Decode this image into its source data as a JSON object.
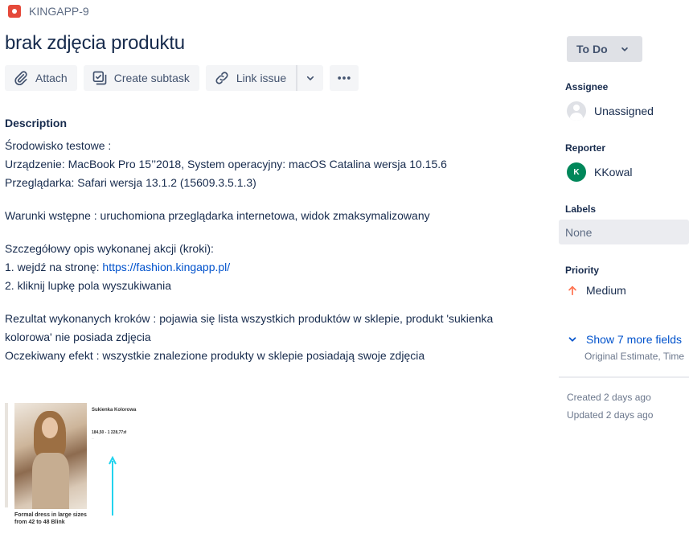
{
  "issue": {
    "key": "KINGAPP-9",
    "type_icon": "bug-icon",
    "title": "brak zdjęcia produktu"
  },
  "toolbar": {
    "attach_label": "Attach",
    "create_subtask_label": "Create subtask",
    "link_issue_label": "Link issue",
    "more_icon": "ellipsis-icon"
  },
  "description": {
    "heading": "Description",
    "env_heading": "Środowisko testowe :",
    "device": "Urządzenie: MacBook Pro 15’’2018, System operacyjny: macOS Catalina wersja 10.15.6",
    "browser": "Przeglądarka: Safari wersja 13.1.2 (15609.3.5.1.3)",
    "preconditions": "Warunki wstępne : uruchomiona przeglądarka internetowa, widok zmaksymalizowany",
    "steps_heading": "Szczegółowy opis wykonanej akcji (kroki):",
    "step1_prefix": "1. wejdź na stronę: ",
    "step1_link": "https://fashion.kingapp.pl/",
    "step2": "2. kliknij lupkę pola wyszukiwania",
    "result": "Rezultat wykonanych kroków : pojawia się lista wszystkich produktów w sklepie, produkt 'sukienka kolorowa' nie posiada zdjęcia",
    "expected": "Oczekiwany efekt : wszystkie znalezione produkty w sklepie posiadają swoje zdjęcia"
  },
  "attachment": {
    "product_name": "Sukienka Kolorowa",
    "price": "184,50 - 1 228,77zł",
    "price_sub": "...",
    "caption": "Formal dress in large sizes from 42 to 48 Blink"
  },
  "sidebar": {
    "status": "To Do",
    "assignee_label": "Assignee",
    "assignee_value": "Unassigned",
    "reporter_label": "Reporter",
    "reporter_initial": "K",
    "reporter_value": "KKowal",
    "labels_label": "Labels",
    "labels_value": "None",
    "priority_label": "Priority",
    "priority_value": "Medium",
    "priority_color": "#ff7452",
    "show_more": "Show 7 more fields",
    "show_more_sub": "Original Estimate, Time",
    "created": "Created 2 days ago",
    "updated": "Updated 2 days ago"
  }
}
